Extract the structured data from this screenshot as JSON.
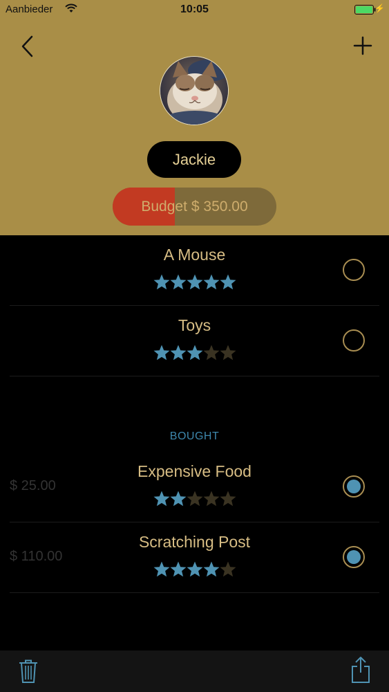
{
  "status_bar": {
    "carrier": "Aanbieder",
    "time": "10:05",
    "battery_color": "#4cd964"
  },
  "header": {
    "background": "#a98e47",
    "name": "Jackie",
    "budget_label": "Budget",
    "budget_value": "$ 350.00",
    "budget_spent_fraction": 0.38
  },
  "wishlist": [
    {
      "title": "A Mouse",
      "rating": 5,
      "checked": false
    },
    {
      "title": "Toys",
      "rating": 3,
      "checked": false
    }
  ],
  "bought_section": {
    "header": "BOUGHT",
    "items": [
      {
        "title": "Expensive Food",
        "rating": 2,
        "price": "$ 25.00",
        "checked": true
      },
      {
        "title": "Scratching Post",
        "rating": 4,
        "price": "$ 110.00",
        "checked": true
      }
    ]
  },
  "colors": {
    "accent_blue": "#4f93b3",
    "star_empty": "#3a3322",
    "text_gold": "#d7bd84",
    "budget_red": "#c23a22"
  },
  "toolbar": {
    "left_icon": "trash-icon",
    "right_icon": "share-icon"
  }
}
